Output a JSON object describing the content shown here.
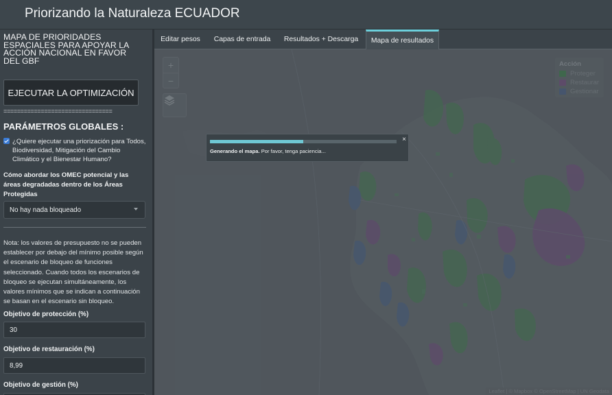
{
  "app": {
    "title": "Priorizando la Naturaleza ECUADOR"
  },
  "sidebar": {
    "heading": "MAPA DE PRIORIDADES ESPACIALES PARA APOYAR LA ACCIÓN NACIONAL EN FAVOR DEL GBF",
    "run_button": "EJECUTAR LA OPTIMIZACIÓN",
    "separator": "================================",
    "global_params_heading": "PARÁMETROS GLOBALES :",
    "checkbox_label": "¿Quiere ejecutar una priorización para Todos, Biodiversidad, Mitigación del Cambio Climático y el Bienestar Humano?",
    "checkbox_checked": true,
    "omec_question": "Cómo abordar los OMEC potencial y las áreas degradadas dentro de los Áreas Protegidas",
    "omec_select_value": "No hay nada bloqueado",
    "note": "Nota: los valores de presupuesto no se pueden establecer por debajo del mínimo posible según el escenario de bloqueo de funciones seleccionado. Cuando todos los escenarios de bloqueo se ejecutan simultáneamente, los valores mínimos que se indican a continuación se basan en el escenario sin bloqueo.",
    "protection_label": "Objetivo de protección (%)",
    "protection_value": "30",
    "restoration_label": "Objetivo de restauración (%)",
    "restoration_value": "8,99",
    "management_label": "Objetivo de gestión (%)"
  },
  "tabs": [
    {
      "label": "Editar pesos",
      "active": false
    },
    {
      "label": "Capas de entrada",
      "active": false
    },
    {
      "label": "Resultados + Descarga",
      "active": false
    },
    {
      "label": "Mapa de resultados",
      "active": true
    }
  ],
  "map": {
    "zoom_in": "+",
    "zoom_out": "−",
    "legend": {
      "title": "Acción",
      "items": [
        {
          "label": "Proteger",
          "color": "#3f7a4e"
        },
        {
          "label": "Restaurar",
          "color": "#6e4f7a"
        },
        {
          "label": "Gestionar",
          "color": "#4b5f80"
        }
      ]
    },
    "attribution": "Leaflet | © Mapbox © OpenStreetMap | UN Geodata"
  },
  "progress": {
    "title": "Generando el mapa.",
    "message": "Por favor, tenga paciencia...",
    "fraction": 0.5,
    "close": "×"
  }
}
